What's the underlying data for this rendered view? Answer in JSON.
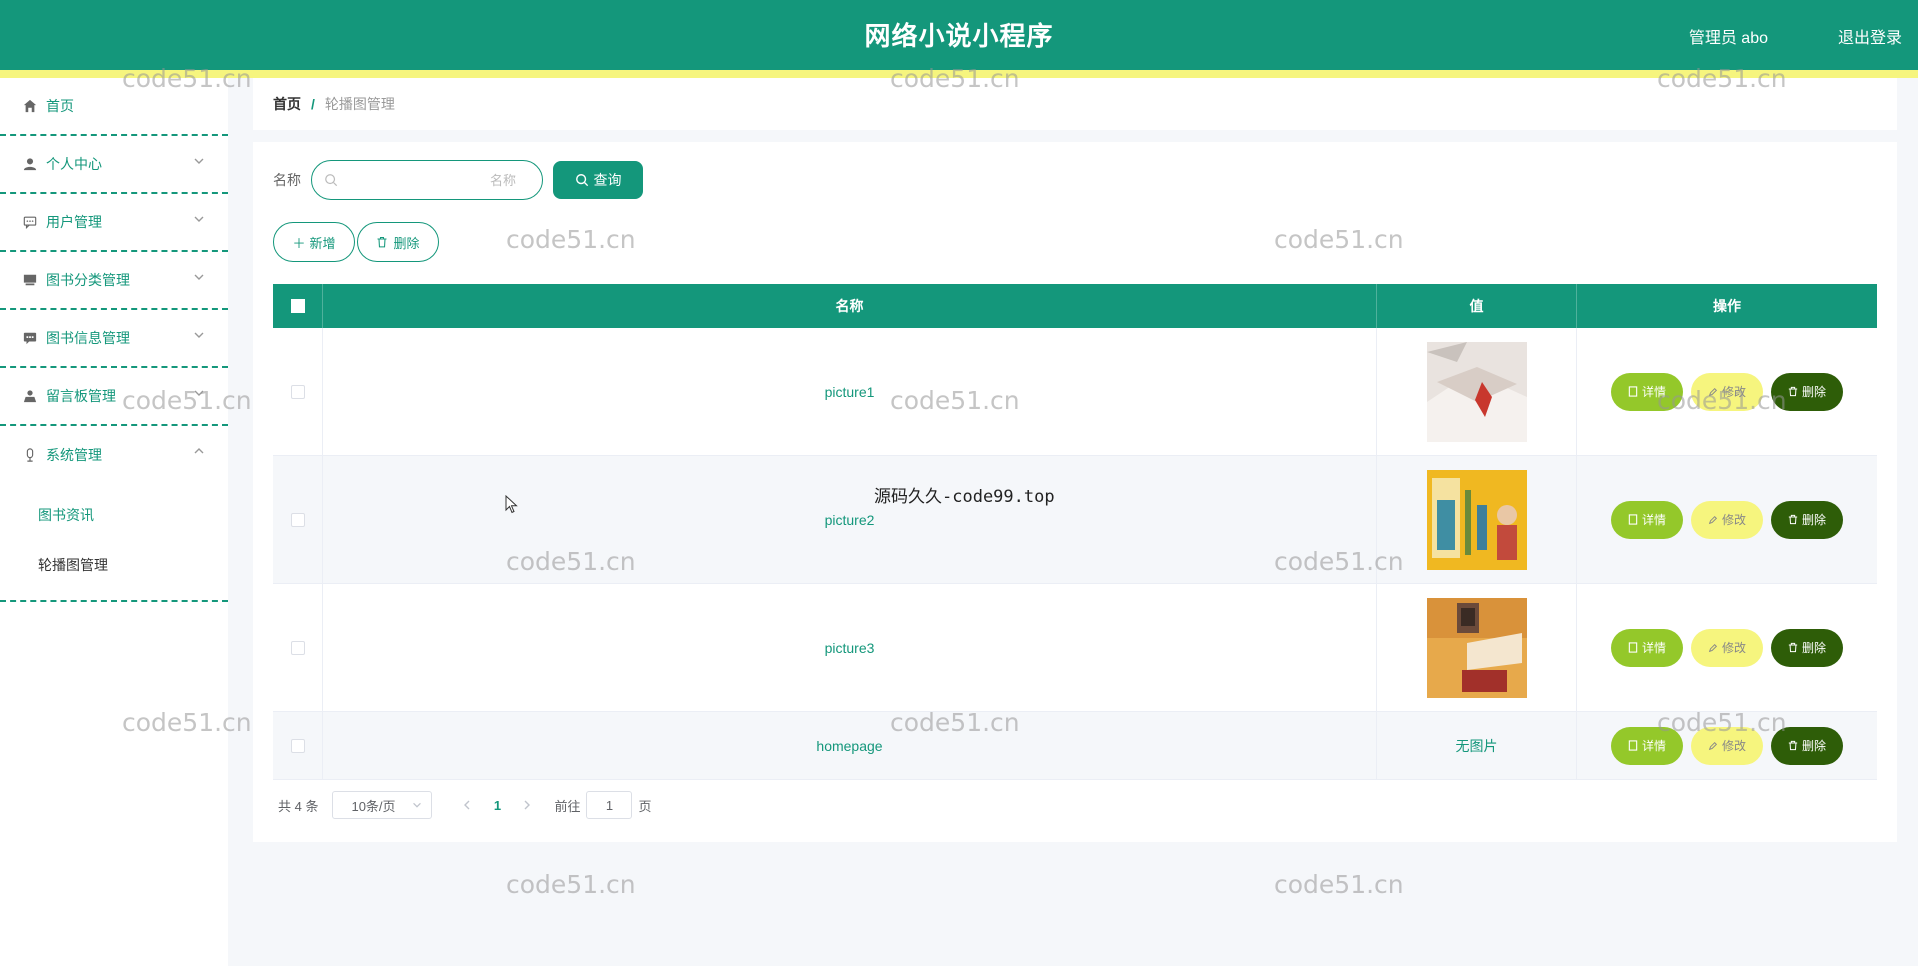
{
  "header": {
    "title": "网络小说小程序",
    "user": "管理员 abo",
    "logout": "退出登录"
  },
  "sidebar": {
    "items": [
      {
        "label": "首页",
        "icon": "home-icon"
      },
      {
        "label": "个人中心",
        "icon": "user-icon"
      },
      {
        "label": "用户管理",
        "icon": "chat-icon"
      },
      {
        "label": "图书分类管理",
        "icon": "grid-icon"
      },
      {
        "label": "图书信息管理",
        "icon": "message-icon"
      },
      {
        "label": "留言板管理",
        "icon": "person-icon"
      },
      {
        "label": "系统管理",
        "icon": "microphone-icon"
      }
    ],
    "subitems": [
      {
        "label": "图书资讯"
      },
      {
        "label": "轮播图管理"
      }
    ]
  },
  "breadcrumb": {
    "home": "首页",
    "separator": "/",
    "current": "轮播图管理"
  },
  "search": {
    "label": "名称",
    "placeholder": "名称",
    "button": "查询"
  },
  "actions": {
    "add": "新增",
    "delete": "删除"
  },
  "table": {
    "headers": {
      "name": "名称",
      "value": "值",
      "ops": "操作"
    },
    "rows": [
      {
        "name": "picture1",
        "value_type": "image"
      },
      {
        "name": "picture2",
        "value_type": "image"
      },
      {
        "name": "picture3",
        "value_type": "image"
      },
      {
        "name": "homepage",
        "value_type": "text",
        "value_text": "无图片"
      }
    ],
    "op_labels": {
      "detail": "详情",
      "edit": "修改",
      "delete": "删除"
    }
  },
  "pagination": {
    "total": "共 4 条",
    "page_size": "10条/页",
    "current_page": "1",
    "goto_label": "前往",
    "goto_value": "1",
    "page_suffix": "页"
  },
  "watermarks": {
    "text": "code51.cn",
    "center": "源码久久-code99.top"
  },
  "colors": {
    "primary": "#14977b",
    "accent_yellow": "#f6f57e",
    "detail_green": "#94c82a",
    "delete_dark": "#2e5d08"
  }
}
